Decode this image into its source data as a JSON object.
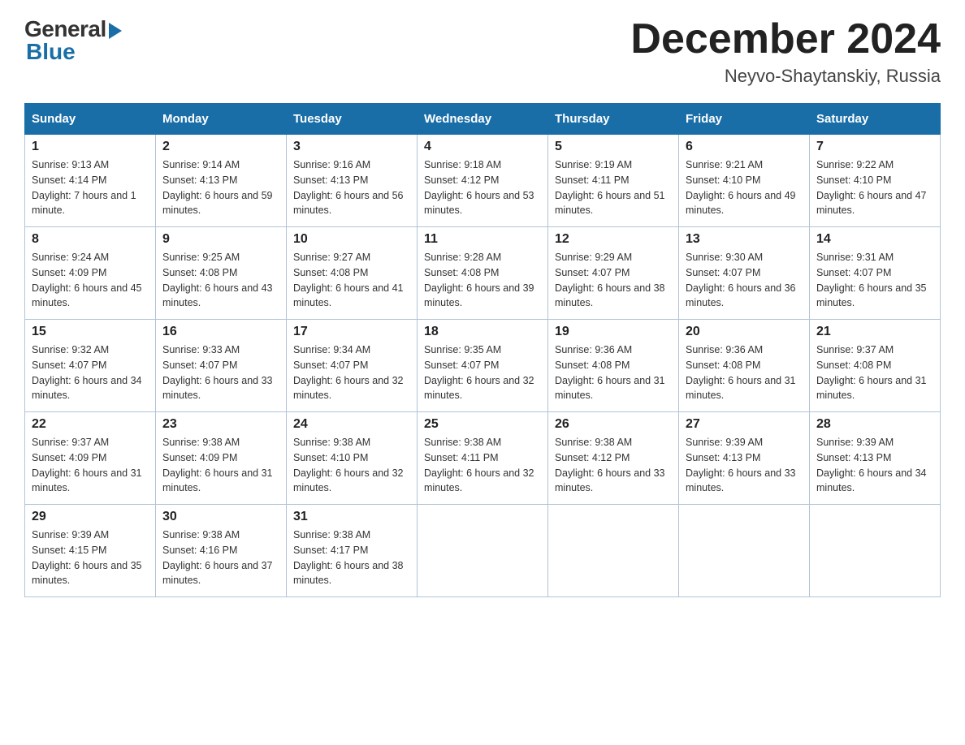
{
  "logo": {
    "general_text": "General",
    "blue_text": "Blue"
  },
  "header": {
    "month": "December 2024",
    "location": "Neyvo-Shaytanskiy, Russia"
  },
  "days_of_week": [
    "Sunday",
    "Monday",
    "Tuesday",
    "Wednesday",
    "Thursday",
    "Friday",
    "Saturday"
  ],
  "weeks": [
    [
      {
        "day": "1",
        "sunrise": "9:13 AM",
        "sunset": "4:14 PM",
        "daylight": "7 hours and 1 minute."
      },
      {
        "day": "2",
        "sunrise": "9:14 AM",
        "sunset": "4:13 PM",
        "daylight": "6 hours and 59 minutes."
      },
      {
        "day": "3",
        "sunrise": "9:16 AM",
        "sunset": "4:13 PM",
        "daylight": "6 hours and 56 minutes."
      },
      {
        "day": "4",
        "sunrise": "9:18 AM",
        "sunset": "4:12 PM",
        "daylight": "6 hours and 53 minutes."
      },
      {
        "day": "5",
        "sunrise": "9:19 AM",
        "sunset": "4:11 PM",
        "daylight": "6 hours and 51 minutes."
      },
      {
        "day": "6",
        "sunrise": "9:21 AM",
        "sunset": "4:10 PM",
        "daylight": "6 hours and 49 minutes."
      },
      {
        "day": "7",
        "sunrise": "9:22 AM",
        "sunset": "4:10 PM",
        "daylight": "6 hours and 47 minutes."
      }
    ],
    [
      {
        "day": "8",
        "sunrise": "9:24 AM",
        "sunset": "4:09 PM",
        "daylight": "6 hours and 45 minutes."
      },
      {
        "day": "9",
        "sunrise": "9:25 AM",
        "sunset": "4:08 PM",
        "daylight": "6 hours and 43 minutes."
      },
      {
        "day": "10",
        "sunrise": "9:27 AM",
        "sunset": "4:08 PM",
        "daylight": "6 hours and 41 minutes."
      },
      {
        "day": "11",
        "sunrise": "9:28 AM",
        "sunset": "4:08 PM",
        "daylight": "6 hours and 39 minutes."
      },
      {
        "day": "12",
        "sunrise": "9:29 AM",
        "sunset": "4:07 PM",
        "daylight": "6 hours and 38 minutes."
      },
      {
        "day": "13",
        "sunrise": "9:30 AM",
        "sunset": "4:07 PM",
        "daylight": "6 hours and 36 minutes."
      },
      {
        "day": "14",
        "sunrise": "9:31 AM",
        "sunset": "4:07 PM",
        "daylight": "6 hours and 35 minutes."
      }
    ],
    [
      {
        "day": "15",
        "sunrise": "9:32 AM",
        "sunset": "4:07 PM",
        "daylight": "6 hours and 34 minutes."
      },
      {
        "day": "16",
        "sunrise": "9:33 AM",
        "sunset": "4:07 PM",
        "daylight": "6 hours and 33 minutes."
      },
      {
        "day": "17",
        "sunrise": "9:34 AM",
        "sunset": "4:07 PM",
        "daylight": "6 hours and 32 minutes."
      },
      {
        "day": "18",
        "sunrise": "9:35 AM",
        "sunset": "4:07 PM",
        "daylight": "6 hours and 32 minutes."
      },
      {
        "day": "19",
        "sunrise": "9:36 AM",
        "sunset": "4:08 PM",
        "daylight": "6 hours and 31 minutes."
      },
      {
        "day": "20",
        "sunrise": "9:36 AM",
        "sunset": "4:08 PM",
        "daylight": "6 hours and 31 minutes."
      },
      {
        "day": "21",
        "sunrise": "9:37 AM",
        "sunset": "4:08 PM",
        "daylight": "6 hours and 31 minutes."
      }
    ],
    [
      {
        "day": "22",
        "sunrise": "9:37 AM",
        "sunset": "4:09 PM",
        "daylight": "6 hours and 31 minutes."
      },
      {
        "day": "23",
        "sunrise": "9:38 AM",
        "sunset": "4:09 PM",
        "daylight": "6 hours and 31 minutes."
      },
      {
        "day": "24",
        "sunrise": "9:38 AM",
        "sunset": "4:10 PM",
        "daylight": "6 hours and 32 minutes."
      },
      {
        "day": "25",
        "sunrise": "9:38 AM",
        "sunset": "4:11 PM",
        "daylight": "6 hours and 32 minutes."
      },
      {
        "day": "26",
        "sunrise": "9:38 AM",
        "sunset": "4:12 PM",
        "daylight": "6 hours and 33 minutes."
      },
      {
        "day": "27",
        "sunrise": "9:39 AM",
        "sunset": "4:13 PM",
        "daylight": "6 hours and 33 minutes."
      },
      {
        "day": "28",
        "sunrise": "9:39 AM",
        "sunset": "4:13 PM",
        "daylight": "6 hours and 34 minutes."
      }
    ],
    [
      {
        "day": "29",
        "sunrise": "9:39 AM",
        "sunset": "4:15 PM",
        "daylight": "6 hours and 35 minutes."
      },
      {
        "day": "30",
        "sunrise": "9:38 AM",
        "sunset": "4:16 PM",
        "daylight": "6 hours and 37 minutes."
      },
      {
        "day": "31",
        "sunrise": "9:38 AM",
        "sunset": "4:17 PM",
        "daylight": "6 hours and 38 minutes."
      },
      null,
      null,
      null,
      null
    ]
  ]
}
